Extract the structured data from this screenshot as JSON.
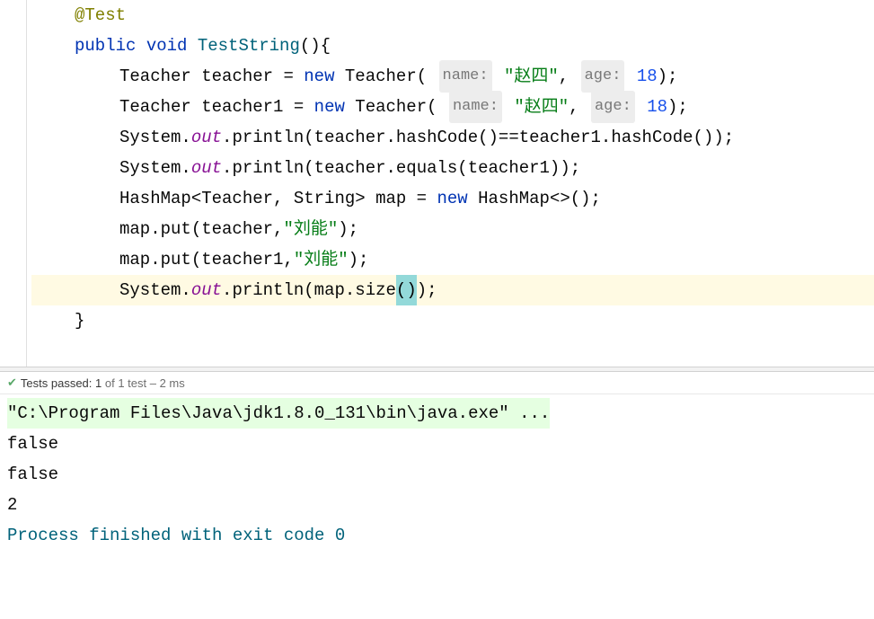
{
  "code": {
    "annotation": "@Test",
    "kw_public": "public",
    "kw_void": "void",
    "method": "TestString",
    "open_sig": "(){",
    "type_teacher": "Teacher",
    "var_teacher": "teacher",
    "var_teacher1": "teacher1",
    "assign": " = ",
    "kw_new": "new",
    "ctor_open": "(",
    "hint_name": "name:",
    "str_zhaosi": "\"赵四\"",
    "comma_sp": ", ",
    "hint_age": "age:",
    "num_18": "18",
    "ctor_close": ");",
    "system": "System",
    "dot": ".",
    "out": "out",
    "println": "println",
    "hash_call": "(teacher.hashCode()==teacher1.hashCode());",
    "equals_call": "(teacher.equals(teacher1));",
    "hashmap": "HashMap",
    "generic_open": "<Teacher, String> ",
    "var_map": "map",
    "diamond": "HashMap<>();",
    "map_put1_a": "map.put(teacher,",
    "map_put1_b": "\"刘能\"",
    "map_put_close": ");",
    "map_put2_a": "map.put(teacher1,",
    "map_put2_b": "\"刘能\"",
    "size_open": "(map.size",
    "size_paren_l": "(",
    "size_paren_r": ")",
    "size_close": ");",
    "close_brace": "}"
  },
  "test_status": {
    "check": "✔",
    "label_prefix": "Tests passed:",
    "passed": "1",
    "suffix": "of 1 test – 2 ms"
  },
  "console": {
    "cmd": "\"C:\\Program Files\\Java\\jdk1.8.0_131\\bin\\java.exe\" ...",
    "out1": "false",
    "out2": "false",
    "out3": "2",
    "blank": "",
    "exit": "Process finished with exit code 0"
  }
}
